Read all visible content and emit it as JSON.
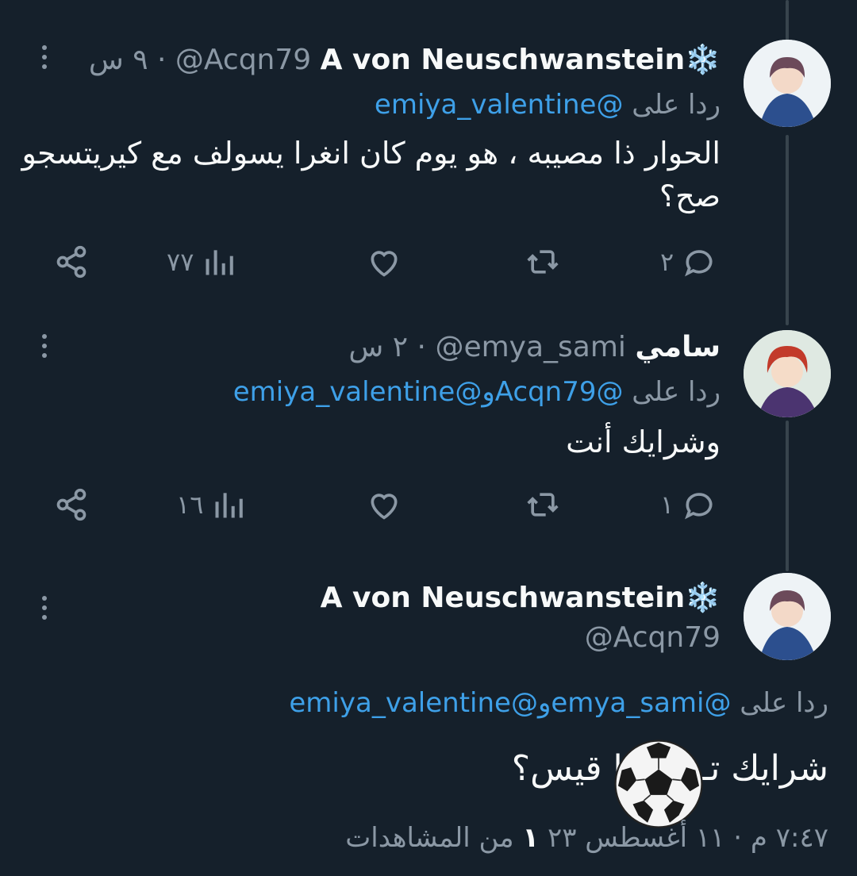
{
  "tweets": [
    {
      "name": "A von Neuschwanstein",
      "name_emoji": "❄️",
      "handle": "@Acqn79",
      "separator": "·",
      "time": "٩ س",
      "reply_prefix": "ردا على",
      "reply_to": "@emiya_valentine",
      "text": "الحوار ذا مصيبه ، هو يوم كان انغرا يسولف مع كيريتسجو\nصح؟",
      "replies": "٢",
      "views": "٧٧"
    },
    {
      "name": "سامي",
      "handle": "@emya_sami",
      "separator": "·",
      "time": "٢ س",
      "reply_prefix": "ردا على",
      "reply_to_1": "@Acqn79",
      "reply_conj": "و",
      "reply_to_2": "@emiya_valentine",
      "text": "وشرايك أنت",
      "replies": "١",
      "views": "١٦"
    }
  ],
  "main_tweet": {
    "name": "A von Neuschwanstein",
    "name_emoji": "❄️",
    "handle": "@Acqn79",
    "reply_prefix": "ردا على",
    "reply_to_1": "@emya_sami",
    "reply_conj": "و",
    "reply_to_2": "@emiya_valentine",
    "text_before": "شرايك تـ",
    "text_after": " يا قيس؟",
    "emoji": "soccer-ball",
    "time": "٧:٤٧ م",
    "separator": "·",
    "date": "١١ أغسطس ٢٣",
    "views_count": "١",
    "views_label": "من المشاهدات"
  },
  "colors": {
    "background": "#15202b",
    "text": "#f7f9f9",
    "secondary": "#8b98a5",
    "mention": "#3ea0e8",
    "thread_line": "#38444d"
  },
  "icons": [
    "more-icon",
    "reply-icon",
    "retweet-icon",
    "like-icon",
    "views-icon",
    "share-icon",
    "snowflake-icon",
    "soccer-ball-icon"
  ]
}
